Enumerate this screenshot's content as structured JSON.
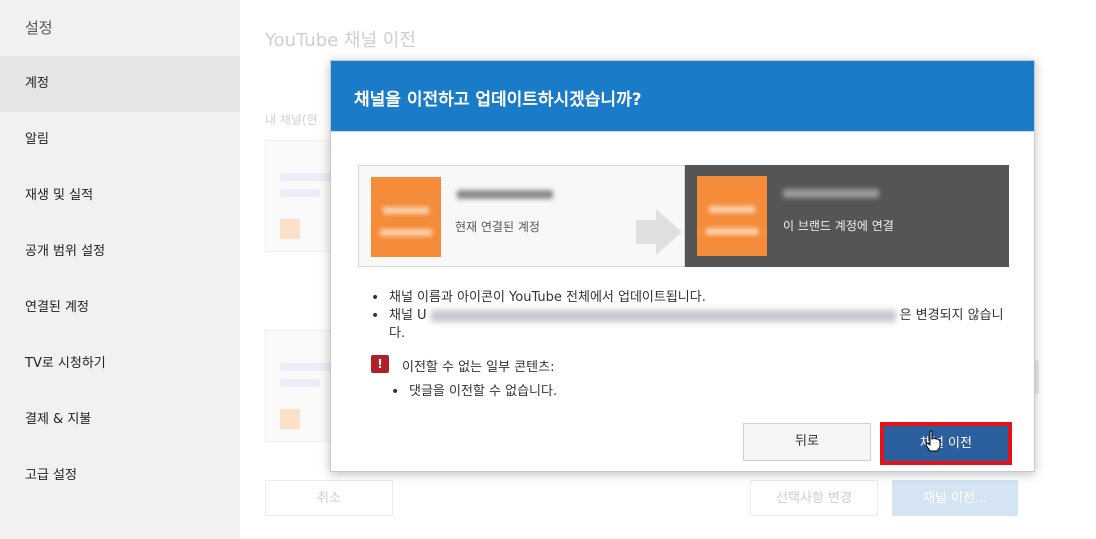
{
  "sidebar": {
    "title": "설정",
    "items": [
      {
        "label": "계정",
        "active": true
      },
      {
        "label": "알림"
      },
      {
        "label": "재생 및 실적"
      },
      {
        "label": "공개 범위 설정"
      },
      {
        "label": "연결된 계정"
      },
      {
        "label": "TV로 시청하기"
      },
      {
        "label": "결제 & 지불"
      },
      {
        "label": "고급 설정"
      }
    ]
  },
  "page": {
    "title": "YouTube 채널 이전",
    "section_label": "내 채널(현",
    "cancel_label": "취소",
    "change_label": "선택사항 변경",
    "move_label": "채널 이전..."
  },
  "dialog": {
    "title": "채널을 이전하고 업데이트하시겠습니까?",
    "current_account_caption": "현재 연결된 계정",
    "target_account_caption": "이 브랜드 계정에 연결",
    "bullets": [
      "채널 이름과 아이콘이 YouTube 전체에서 업데이트됩니다.",
      "채널 U",
      "은 변경되지 않습니다."
    ],
    "warning_icon": "exclamation-icon",
    "warning_text": "이전할 수 없는 일부 콘텐츠:",
    "sub_bullet": "댓글을 이전할 수 없습니다.",
    "back_label": "뒤로",
    "move_label": "채널 이전",
    "header_color": "#1a7cc9",
    "highlight_color": "#e4121b"
  }
}
